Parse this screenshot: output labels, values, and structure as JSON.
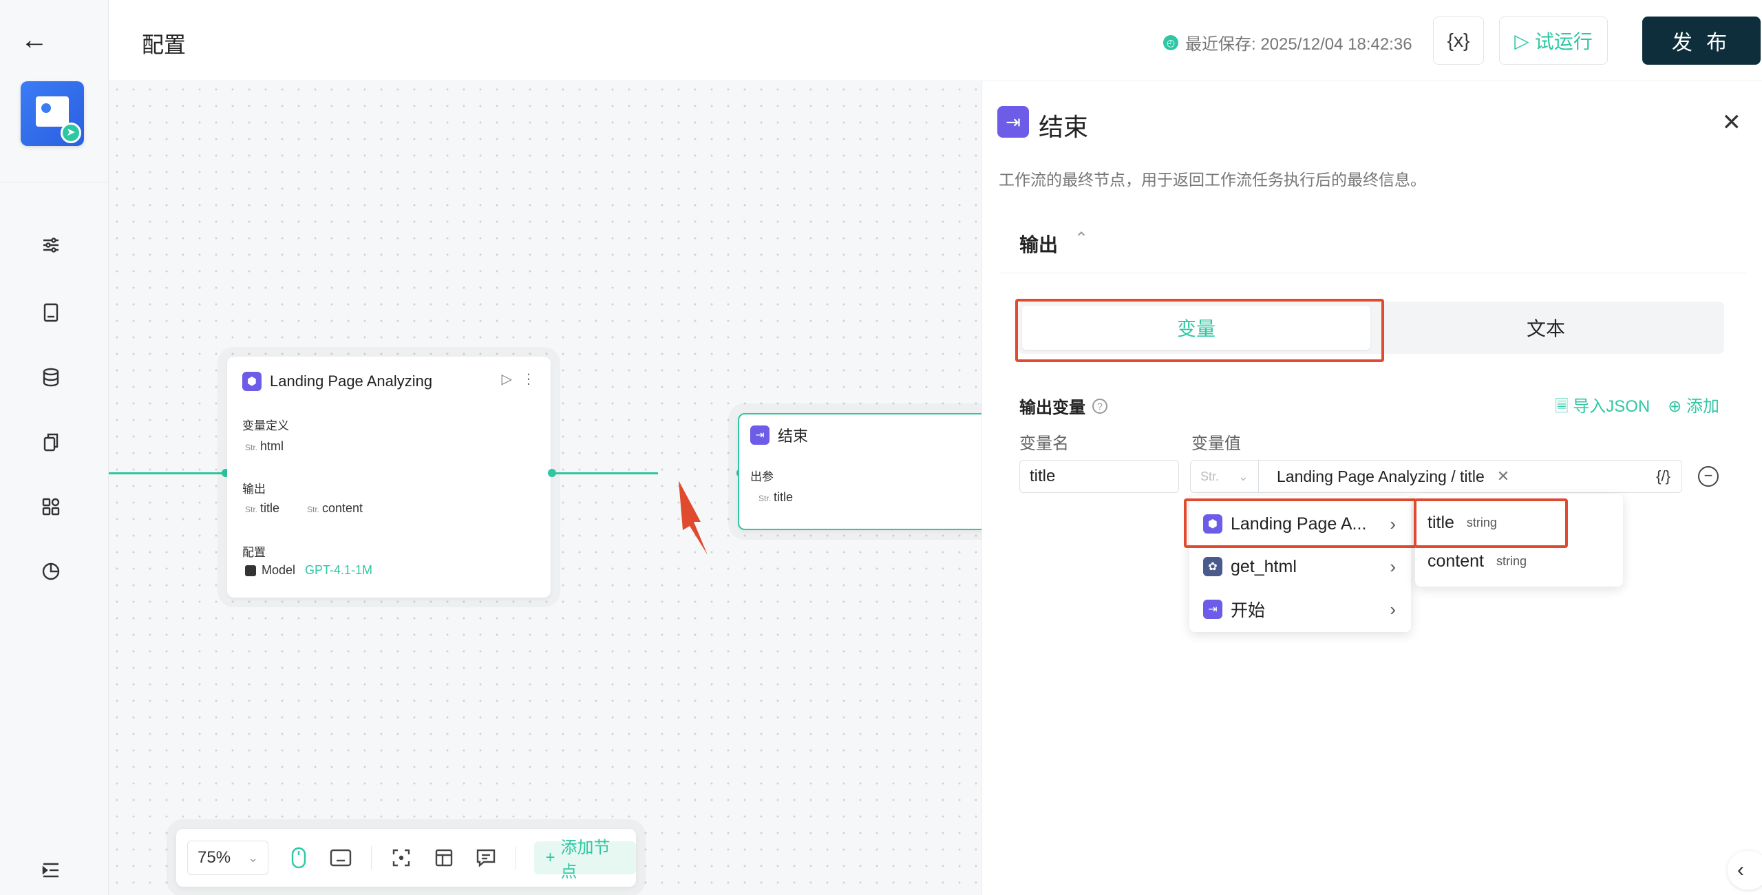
{
  "header": {
    "title": "配置",
    "save_status": "最近保存: 2025/12/04 18:42:36",
    "var_button": "{x}",
    "run_button": "试运行",
    "publish_button": "发 布"
  },
  "canvas": {
    "node_llm": {
      "title": "Landing Page Analyzing",
      "input_label": "变量定义",
      "input_var": "html",
      "output_label": "输出",
      "output_vars": [
        "title",
        "content"
      ],
      "config_label": "配置",
      "model_label": "Model",
      "model_value": "GPT-4.1-1M"
    },
    "node_end": {
      "title": "结束",
      "param_label": "出参",
      "param_var": "title"
    },
    "str_tag": "Str."
  },
  "toolbar": {
    "zoom": "75%",
    "add_node": "添加节点"
  },
  "panel": {
    "title": "结束",
    "description": "工作流的最终节点，用于返回工作流任务执行后的最终信息。",
    "section_title": "输出",
    "tabs": [
      "变量",
      "文本"
    ],
    "output_vars_title": "输出变量",
    "import_json": "导入JSON",
    "add": "添加",
    "col_name": "变量名",
    "col_value": "变量值",
    "row_name": "title",
    "row_type": "Str.",
    "row_value": "Landing Page Analyzing / title",
    "code_icon": "{/}"
  },
  "dropdown": {
    "sources": [
      {
        "label": "Landing Page A...",
        "icon": "llm-node-icon"
      },
      {
        "label": "get_html",
        "icon": "plugin-node-icon"
      },
      {
        "label": "开始",
        "icon": "start-node-icon"
      }
    ],
    "fields": [
      {
        "name": "title",
        "type": "string"
      },
      {
        "name": "content",
        "type": "string"
      }
    ]
  },
  "colors": {
    "accent": "#2ec7a3",
    "highlight": "#e04a2f",
    "publish_bg": "#0d2e3a",
    "node_icon": "#6c5ce7"
  }
}
